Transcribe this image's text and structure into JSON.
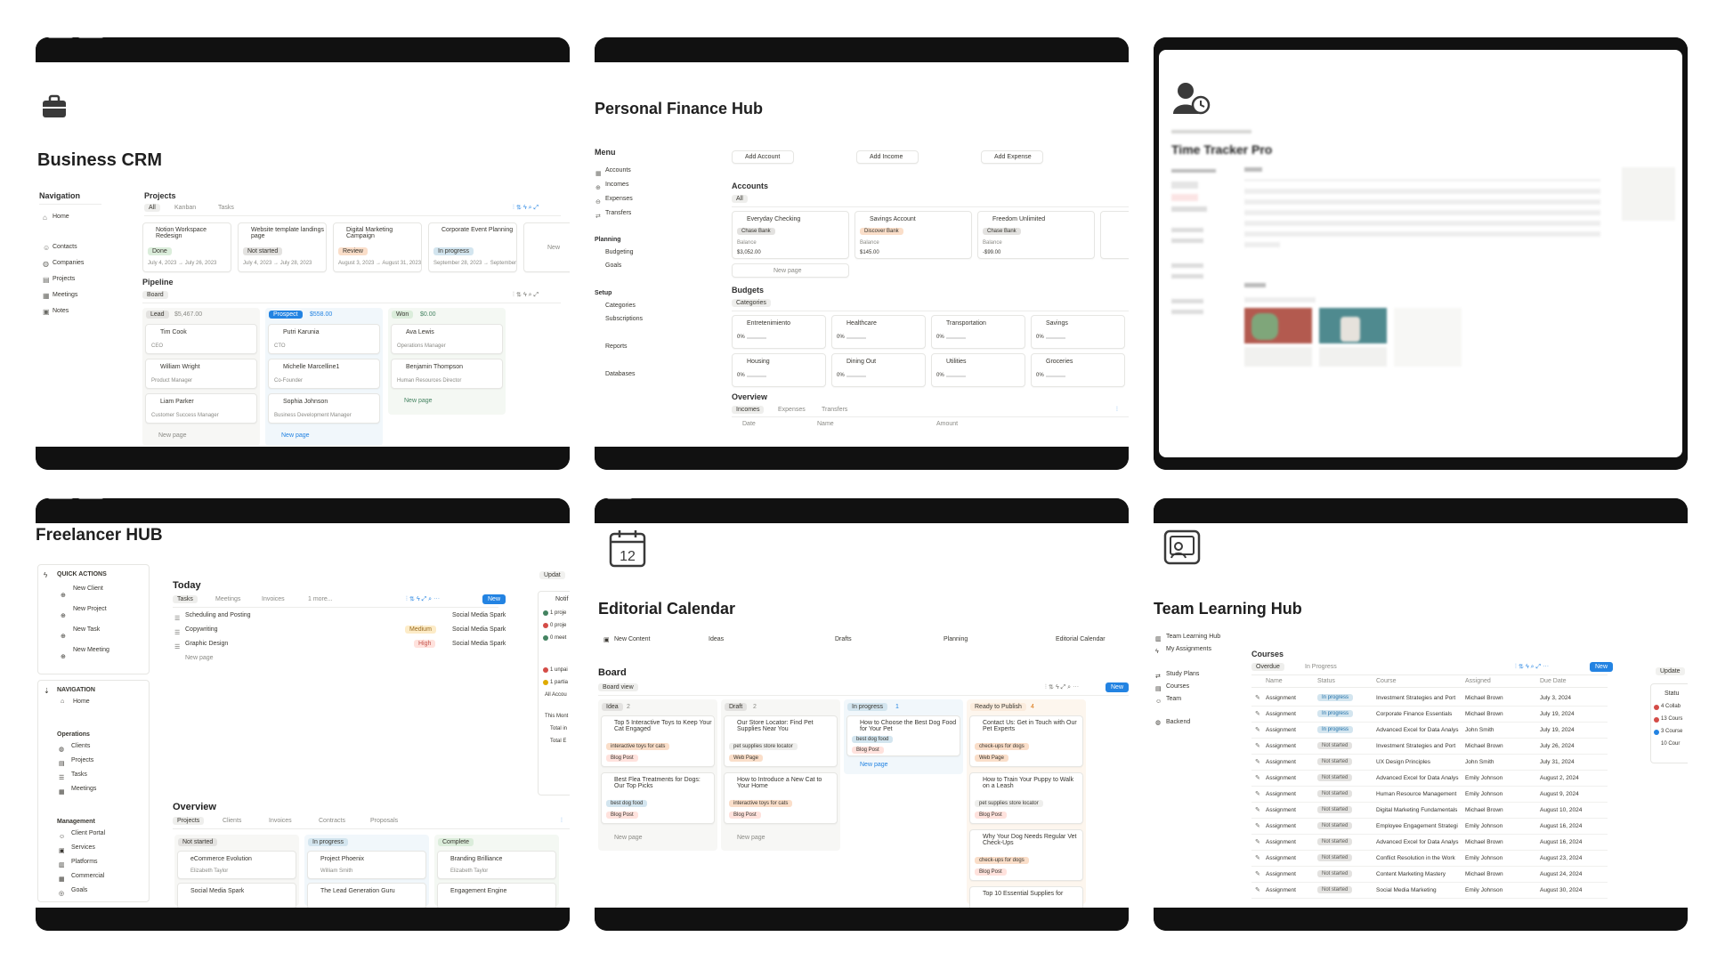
{
  "crm": {
    "title": "Business CRM",
    "nav_title": "Navigation",
    "nav": [
      "Home",
      "Contacts",
      "Companies",
      "Projects",
      "Meetings",
      "Notes"
    ],
    "projects_title": "Projects",
    "projects_tabs": [
      "All",
      "Kanban",
      "Tasks"
    ],
    "projects": [
      {
        "name": "Notion Workspace Redesign",
        "status": "Done",
        "dates": "July 4, 2023 → July 26, 2023"
      },
      {
        "name": "Website template landings page",
        "status": "Not started",
        "dates": "July 4, 2023 → July 28, 2023"
      },
      {
        "name": "Digital Marketing Campaign",
        "status": "Review",
        "dates": "August 3, 2023 → August 31, 2023"
      },
      {
        "name": "Corporate Event Planning",
        "status": "In progress",
        "dates": "September 28, 2023 → September"
      }
    ],
    "new_label": "New",
    "pipeline_title": "Pipeline",
    "pipeline_view": "Board",
    "columns": [
      {
        "label": "Lead",
        "amount": "$5,467.00",
        "cards": [
          {
            "name": "Tim Cook",
            "role": "CEO"
          },
          {
            "name": "William Wright",
            "role": "Product Manager"
          },
          {
            "name": "Liam Parker",
            "role": "Customer Success Manager"
          }
        ],
        "footer": "New page"
      },
      {
        "label": "Prospect",
        "amount": "$558.00",
        "cards": [
          {
            "name": "Putri Karunia",
            "role": "CTO"
          },
          {
            "name": "Michelle Marcelline1",
            "role": "Co-Founder"
          },
          {
            "name": "Sophia Johnson",
            "role": "Business Development Manager"
          }
        ],
        "footer": "New page"
      },
      {
        "label": "Won",
        "amount": "$0.00",
        "cards": [
          {
            "name": "Ava Lewis",
            "role": "Operations Manager"
          },
          {
            "name": "Benjamin Thompson",
            "role": "Human Resources Director"
          }
        ],
        "footer": "New page"
      }
    ]
  },
  "finance": {
    "title": "Personal Finance Hub",
    "menu_title": "Menu",
    "menu": [
      "Accounts",
      "Incomes",
      "Expenses",
      "Transfers"
    ],
    "planning_title": "Planning",
    "planning": [
      "Budgeting",
      "Goals"
    ],
    "setup_title": "Setup",
    "setup": [
      "Categories",
      "Subscriptions"
    ],
    "extra": [
      "Reports",
      "Databases"
    ],
    "actions": [
      "Add Account",
      "Add Income",
      "Add Expense"
    ],
    "accounts_title": "Accounts",
    "accounts_tab": "All",
    "accounts": [
      {
        "name": "Everyday Checking",
        "bank": "Chase Bank",
        "balance_label": "Balance",
        "balance": "$3,052.00"
      },
      {
        "name": "Savings Account",
        "bank": "Discover Bank",
        "balance_label": "Balance",
        "balance": "$145.00"
      },
      {
        "name": "Freedom Unlimited",
        "bank": "Chase Bank",
        "balance_label": "Balance",
        "balance": "-$99.00"
      }
    ],
    "new_page": "New page",
    "budgets_title": "Budgets",
    "budgets_tab": "Categories",
    "budgets": [
      {
        "name": "Entretenimiento",
        "pct": "0%"
      },
      {
        "name": "Healthcare",
        "pct": "0%"
      },
      {
        "name": "Transportation",
        "pct": "0%"
      },
      {
        "name": "Savings",
        "pct": "0%"
      },
      {
        "name": "Housing",
        "pct": "0%"
      },
      {
        "name": "Dining Out",
        "pct": "0%"
      },
      {
        "name": "Utilities",
        "pct": "0%"
      },
      {
        "name": "Groceries",
        "pct": "0%"
      }
    ],
    "overview_title": "Overview",
    "overview_tabs": [
      "Incomes",
      "Expenses",
      "Transfers"
    ],
    "overview_cols": [
      "Date",
      "Name",
      "Amount"
    ]
  },
  "tracker": {
    "title": "Time Tracker Pro"
  },
  "freelancer": {
    "title": "Freelancer HUB",
    "quick_title": "QUICK ACTIONS",
    "quick": [
      "New Client",
      "New Project",
      "New Task",
      "New Meeting"
    ],
    "nav_title": "NAVIGATION",
    "nav_home": "Home",
    "ops_title": "Operations",
    "ops": [
      "Clients",
      "Projects",
      "Tasks",
      "Meetings"
    ],
    "mgmt_title": "Management",
    "mgmt": [
      "Client Portal",
      "Services",
      "Platforms",
      "Commercial",
      "Goals"
    ],
    "today_title": "Today",
    "today_tabs": [
      "Tasks",
      "Meetings",
      "Invoices",
      "1 more..."
    ],
    "new_label": "New",
    "tasks": [
      {
        "name": "Scheduling and Posting",
        "priority": "",
        "project": "Social Media Spark"
      },
      {
        "name": "Copywriting",
        "priority": "Medium",
        "project": "Social Media Spark"
      },
      {
        "name": "Graphic Design",
        "priority": "High",
        "project": "Social Media Spark"
      }
    ],
    "new_page": "New page",
    "overview_title": "Overview",
    "overview_tabs": [
      "Projects",
      "Clients",
      "Invoices",
      "Contracts",
      "Proposals"
    ],
    "columns": [
      {
        "label": "Not started",
        "cards": [
          {
            "name": "eCommerce Evolution",
            "person": "Elizabeth Taylor"
          },
          {
            "name": "Social Media Spark",
            "person": ""
          }
        ]
      },
      {
        "label": "In progress",
        "cards": [
          {
            "name": "Project Phoenix",
            "person": "William Smith"
          },
          {
            "name": "The Lead Generation Guru",
            "person": ""
          }
        ]
      },
      {
        "label": "Complete",
        "cards": [
          {
            "name": "Branding Brilliance",
            "person": "Elizabeth Taylor"
          },
          {
            "name": "Engagement Engine",
            "person": ""
          }
        ]
      }
    ],
    "side_update": "Updat",
    "side_notif": "Notif",
    "side_items": [
      "1 proje",
      "0 proje",
      "0 meet"
    ],
    "side_items2": [
      "1 unpai",
      "1 partia",
      "All Accou"
    ],
    "side_month": "This Mont",
    "side_totals": [
      "Total in",
      "Total E"
    ]
  },
  "editorial": {
    "title": "Editorial Calendar",
    "nav": [
      "New Content",
      "Ideas",
      "Drafts",
      "Planning",
      "Editorial Calendar"
    ],
    "board_title": "Board",
    "board_view": "Board view",
    "new_label": "New",
    "columns": [
      {
        "label": "Idea",
        "count": "2",
        "cards": [
          {
            "title": "Top 5 Interactive Toys to Keep Your Cat Engaged",
            "tag": "interactive toys for cats",
            "type": "Blog Post"
          },
          {
            "title": "Best Flea Treatments for Dogs: Our Top Picks",
            "tag": "best dog food",
            "type": "Blog Post"
          }
        ],
        "footer": "New page"
      },
      {
        "label": "Draft",
        "count": "2",
        "cards": [
          {
            "title": "Our Store Locator: Find Pet Supplies Near You",
            "tag": "pet supplies store locator",
            "type": "Web Page"
          },
          {
            "title": "How to Introduce a New Cat to Your Home",
            "tag": "interactive toys for cats",
            "type": "Blog Post"
          }
        ],
        "footer": "New page"
      },
      {
        "label": "In progress",
        "count": "1",
        "cards": [
          {
            "title": "How to Choose the Best Dog Food for Your Pet",
            "tag": "best dog food",
            "type": "Blog Post"
          }
        ],
        "footer": "New page"
      },
      {
        "label": "Ready to Publish",
        "count": "4",
        "cards": [
          {
            "title": "Contact Us: Get in Touch with Our Pet Experts",
            "tag": "check-ups for dogs",
            "type": "Web Page"
          },
          {
            "title": "How to Train Your Puppy to Walk on a Leash",
            "tag": "pet supplies store locator",
            "type": "Blog Post"
          },
          {
            "title": "Why Your Dog Needs Regular Vet Check-Ups",
            "tag": "check-ups for dogs",
            "type": "Blog Post"
          },
          {
            "title": "Top 10 Essential Supplies for",
            "tag": "",
            "type": ""
          }
        ],
        "footer": ""
      }
    ]
  },
  "learning": {
    "title": "Team Learning Hub",
    "nav": [
      "Team Learning Hub",
      "My Assignments"
    ],
    "nav2": [
      "Study Plans",
      "Courses",
      "Team"
    ],
    "nav3": [
      "Backend"
    ],
    "courses_title": "Courses",
    "tabs": [
      "Overdue",
      "In Progress"
    ],
    "new_label": "New",
    "headers": [
      "Name",
      "Status",
      "Course",
      "Assigned",
      "Due Date"
    ],
    "rows": [
      {
        "name": "Assignment",
        "status": "In progress",
        "course": "Investment Strategies and Port",
        "assigned": "Michael Brown",
        "due": "July 3, 2024"
      },
      {
        "name": "Assignment",
        "status": "In progress",
        "course": "Corporate Finance Essentials",
        "assigned": "Michael Brown",
        "due": "July 19, 2024"
      },
      {
        "name": "Assignment",
        "status": "In progress",
        "course": "Advanced Excel for Data Analys",
        "assigned": "John Smith",
        "due": "July 19, 2024"
      },
      {
        "name": "Assignment",
        "status": "Not started",
        "course": "Investment Strategies and Port",
        "assigned": "Michael Brown",
        "due": "July 26, 2024"
      },
      {
        "name": "Assignment",
        "status": "Not started",
        "course": "UX Design Principles",
        "assigned": "John Smith",
        "due": "July 31, 2024"
      },
      {
        "name": "Assignment",
        "status": "Not started",
        "course": "Advanced Excel for Data Analys",
        "assigned": "Emily Johnson",
        "due": "August 2, 2024"
      },
      {
        "name": "Assignment",
        "status": "Not started",
        "course": "Human Resource Management",
        "assigned": "Emily Johnson",
        "due": "August 9, 2024"
      },
      {
        "name": "Assignment",
        "status": "Not started",
        "course": "Digital Marketing Fundamentals",
        "assigned": "Michael Brown",
        "due": "August 10, 2024"
      },
      {
        "name": "Assignment",
        "status": "Not started",
        "course": "Employee Engagement Strategi",
        "assigned": "Emily Johnson",
        "due": "August 16, 2024"
      },
      {
        "name": "Assignment",
        "status": "Not started",
        "course": "Advanced Excel for Data Analys",
        "assigned": "Michael Brown",
        "due": "August 16, 2024"
      },
      {
        "name": "Assignment",
        "status": "Not started",
        "course": "Conflict Resolution in the Work",
        "assigned": "Emily Johnson",
        "due": "August 23, 2024"
      },
      {
        "name": "Assignment",
        "status": "Not started",
        "course": "Content Marketing Mastery",
        "assigned": "Michael Brown",
        "due": "August 24, 2024"
      },
      {
        "name": "Assignment",
        "status": "Not started",
        "course": "Social Media Marketing",
        "assigned": "Emily Johnson",
        "due": "August 30, 2024"
      }
    ],
    "side_update": "Update",
    "side_status": "Statu",
    "side_items": [
      "4 Collab",
      "13 Cours",
      "3 Course",
      "10 Cour"
    ]
  },
  "colors": {
    "accent": "#2383e2",
    "done": "#dbeddb",
    "not_started": "#e3e2e0",
    "review": "#fadec9",
    "in_progress": "#d3e5ef",
    "lead": "#f1f1ef",
    "prospect": "#e7f3f8",
    "won": "#edf3ec",
    "ready": "#fbecdd",
    "medium": "#fdecc8",
    "high": "#ffe2dd",
    "blog": "#ffe2dd",
    "web": "#fadec9"
  }
}
